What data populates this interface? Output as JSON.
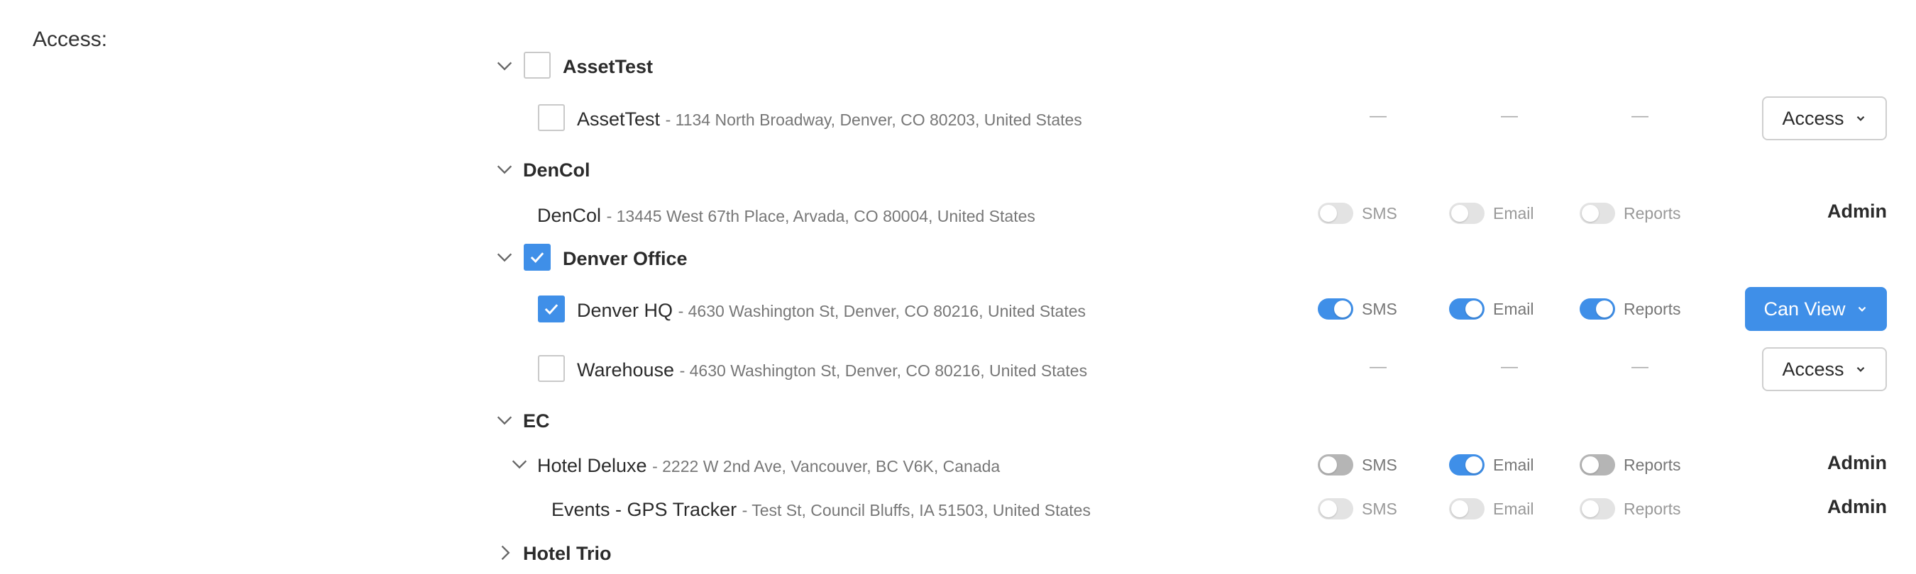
{
  "access_label": "Access:",
  "colors": {
    "accent": "#3f8fe8",
    "toggle_off": "#d4d4d4"
  },
  "groups": [
    {
      "name": "AssetTest",
      "locations": [
        {
          "name": "AssetTest",
          "address": "- 1134 North Broadway, Denver, CO 80203, United States",
          "dash": "—",
          "role": "Access"
        }
      ]
    },
    {
      "name": "DenCol",
      "locations": [
        {
          "name": "DenCol",
          "address": "- 13445 West 67th Place, Arvada, CO 80004, United States",
          "sms": "SMS",
          "email": "Email",
          "reports": "Reports",
          "role": "Admin"
        }
      ]
    },
    {
      "name": "Denver Office",
      "locations": [
        {
          "name": "Denver HQ",
          "address": "- 4630 Washington St, Denver, CO 80216, United States",
          "sms": "SMS",
          "email": "Email",
          "reports": "Reports",
          "role": "Can View"
        },
        {
          "name": "Warehouse",
          "address": "- 4630 Washington St, Denver, CO 80216, United States",
          "dash": "—",
          "role": "Access"
        }
      ]
    },
    {
      "name": "EC",
      "locations": [
        {
          "name": "Hotel Deluxe",
          "address": "- 2222 W 2nd Ave, Vancouver, BC V6K, Canada",
          "sms": "SMS",
          "email": "Email",
          "reports": "Reports",
          "role": "Admin"
        },
        {
          "name": "Events - GPS Tracker",
          "address": "- Test St, Council Bluffs, IA 51503, United States",
          "sms": "SMS",
          "email": "Email",
          "reports": "Reports",
          "role": "Admin"
        }
      ]
    },
    {
      "name": "Hotel Trio",
      "locations": []
    }
  ]
}
